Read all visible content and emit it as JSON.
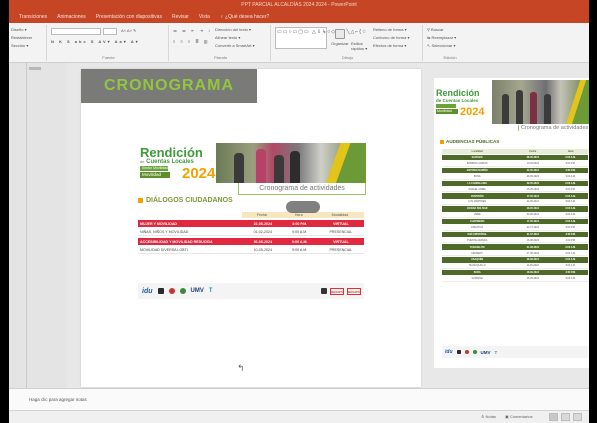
{
  "window": {
    "title": "PPT PARCIAL ALCALDÍAS 2024 2024 - PowerPoint"
  },
  "tabs": [
    {
      "label": "Transiciones"
    },
    {
      "label": "Animaciones"
    },
    {
      "label": "Presentación con diapositivas"
    },
    {
      "label": "Revisar"
    },
    {
      "label": "Vista"
    },
    {
      "label": "¿Qué desea hacer?"
    }
  ],
  "ribbon": {
    "left_items": [
      "Diseño ▾",
      "Restablecer",
      "Sección ▾"
    ],
    "groups": [
      "Fuente",
      "Párrafo",
      "Dibujo",
      "Edición"
    ],
    "paragraph_items": [
      "Dirección del texto ▾",
      "Alinear texto ▾",
      "Convertir a SmartArt ▾"
    ],
    "drawing_items": [
      "Organizar",
      "Estilos rápidos ▾",
      "Relleno de forma ▾",
      "Contorno de forma ▾",
      "Efectos de forma ▾"
    ],
    "editing_items": [
      "Buscar",
      "Reemplazar ▾",
      "Seleccionar ▾"
    ]
  },
  "slide": {
    "title": "CRONOGRAMA",
    "poster": {
      "heading": "Rendición",
      "sub_de": "de",
      "sub": "Cuentas Locales",
      "tag_top": "Sector Movilidad",
      "tag_mov": "Movilidad",
      "year": "2024",
      "cronograma": "Cronograma de actividades",
      "dc_title": "DIÁLOGOS CIUDADANOS",
      "columns": [
        "Fecha",
        "Hora",
        "Modalidad"
      ],
      "rows": [
        {
          "name": "MUJER Y MOVILIDAD",
          "date": "22-05-2024",
          "time": "3:00 P.M.",
          "mode": "VIRTUAL",
          "style": "red"
        },
        {
          "name": "NIÑAS, NIÑOS Y MOVILIDAD",
          "date": "01-02-2024",
          "time": "9:00 A.M.",
          "mode": "PRESENCIAL",
          "style": "white"
        },
        {
          "name": "ACCESIBILIDAD Y MOVILIDAD REDUCIDA",
          "date": "30-05-2024",
          "time": "9:00 A.M.",
          "mode": "VIRTUAL",
          "style": "red"
        },
        {
          "name": "MOVILIDAD DIVERSA LGBTI",
          "date": "10-05-2024",
          "time": "9:00 A.M.",
          "mode": "PRESENCIAL",
          "style": "white"
        }
      ],
      "logos": {
        "idu": "idu",
        "umv": "UMV",
        "t": "T",
        "bogota": "BOGOTÁ"
      }
    }
  },
  "right_poster": {
    "heading": "Rendición",
    "sub": "de Cuentas Locales",
    "tag": "Movilidad",
    "year": "2024",
    "cronograma": "Cronograma de actividades",
    "aud_title": "AUDIENCIAS PÚBLICAS",
    "columns": [
      "Localidad",
      "Fecha",
      "Hora"
    ],
    "rows": [
      {
        "loc": "SANTAFE",
        "date": "08-05-2024",
        "time": "9:00 A.M.",
        "style": "dk"
      },
      {
        "loc": "BARRIOS UNIDOS",
        "date": "10-05-2024",
        "time": "3:00 P.M.",
        "style": "lt"
      },
      {
        "loc": "ANTONIO NARIÑO",
        "date": "22-05-2024",
        "time": "3:00 P.M.",
        "style": "dk"
      },
      {
        "loc": "BOSA",
        "date": "29-05-2024",
        "time": "9:00 A.M.",
        "style": "lt"
      },
      {
        "loc": "LA CANDELARIA",
        "date": "09-05-2024",
        "time": "9:00 A.M.",
        "style": "dk"
      },
      {
        "loc": "RAFAEL URIBE",
        "date": "15-05-2024",
        "time": "3:00 P.M.",
        "style": "lt"
      },
      {
        "loc": "FONTIBÓN",
        "date": "17-05-2024",
        "time": "9:00 A.M.",
        "style": "dk"
      },
      {
        "loc": "LOS MÁRTIRES",
        "date": "24-05-2024",
        "time": "9:00 A.M.",
        "style": "lt"
      },
      {
        "loc": "CIUDAD BOLÍVAR",
        "date": "28-05-2024",
        "time": "9:00 A.M.",
        "style": "dk"
      },
      {
        "loc": "USME",
        "date": "30-05-2024",
        "time": "9:00 A.M.",
        "style": "lt"
      },
      {
        "loc": "CHAPINERO",
        "date": "17-05-2024",
        "time": "9:00 A.M.",
        "style": "dk"
      },
      {
        "loc": "ENGATIVÁ",
        "date": "24-07-2024",
        "time": "3:00 P.M.",
        "style": "lt"
      },
      {
        "loc": "SAN CRISTÓBAL",
        "date": "31-07-2024",
        "time": "3:00 P.M.",
        "style": "dk"
      },
      {
        "loc": "PUENTE ARANDA",
        "date": "16-08-2024",
        "time": "3:00 P.M.",
        "style": "lt"
      },
      {
        "loc": "TUNJUELITO",
        "date": "21-08-2024",
        "time": "9:00 A.M.",
        "style": "dk"
      },
      {
        "loc": "KENNEDY",
        "date": "27-08-2024",
        "time": "9:00 A.M.",
        "style": "lt"
      },
      {
        "loc": "USAQUÉN",
        "date": "28-08-2024",
        "time": "9:00 A.M.",
        "style": "dk"
      },
      {
        "loc": "TEUSAQUILLO",
        "date": "11-09-2024",
        "time": "9:00 A.M.",
        "style": "lt"
      },
      {
        "loc": "SUBA",
        "date": "18-09-2024",
        "time": "3:00 P.M.",
        "style": "dk"
      },
      {
        "loc": "SUMAPAZ",
        "date": "25-09-2024",
        "time": "9:00 A.M.",
        "style": "lt"
      }
    ]
  },
  "notes": {
    "placeholder": "Haga clic para agregar notas"
  },
  "status": {
    "notes_label": "≙ Notas",
    "comments_label": "▣ Comentarios"
  },
  "colors": {
    "ribbon_red": "#c64524",
    "title_green": "#91c63e",
    "dc_red": "#e0293f",
    "aud_green": "#4f6a28",
    "accent_orange": "#f2a100"
  }
}
